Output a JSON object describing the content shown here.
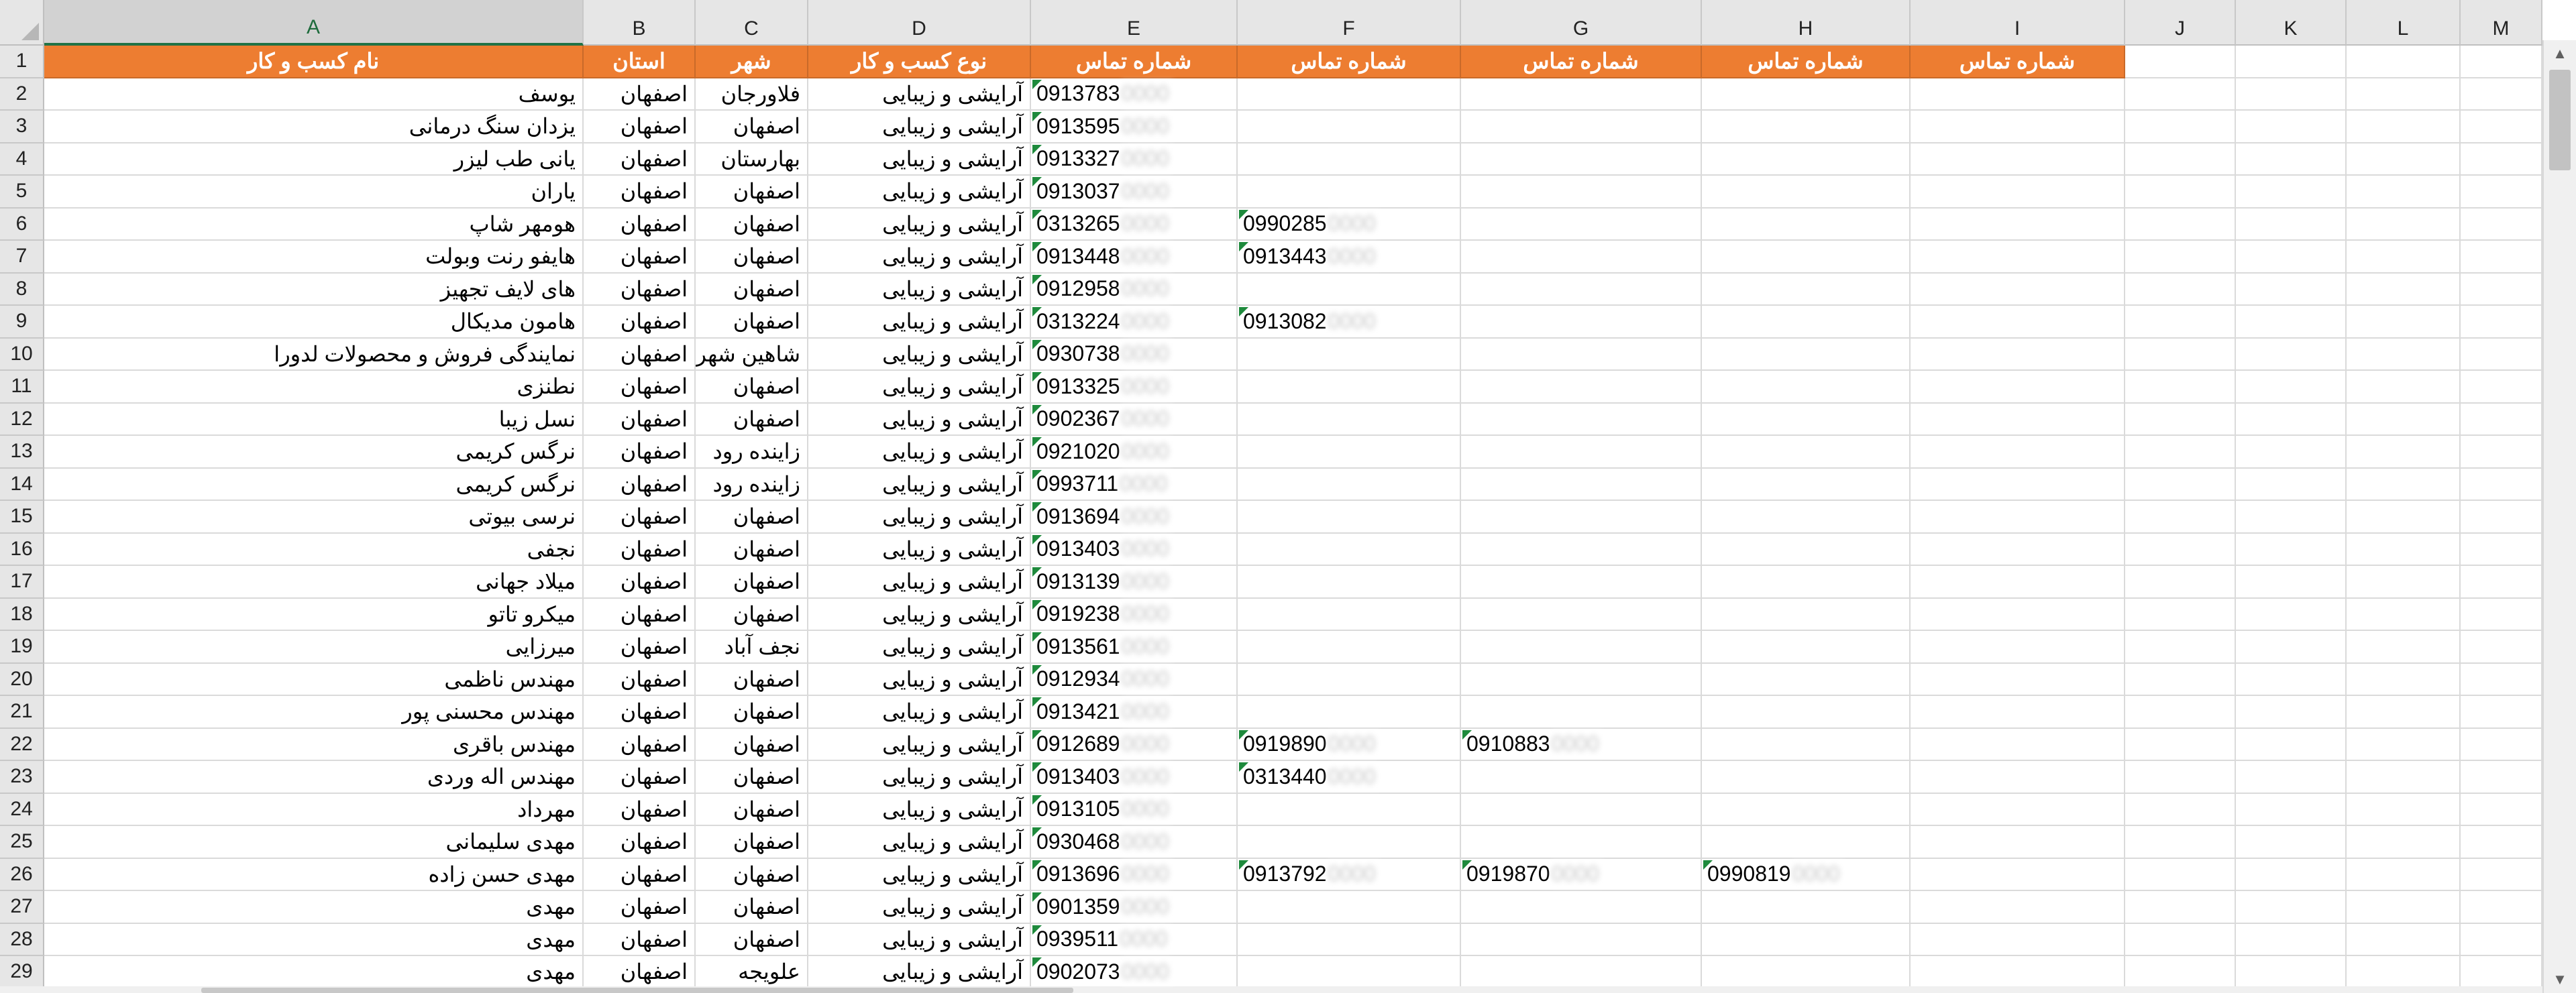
{
  "columns": [
    "A",
    "B",
    "C",
    "D",
    "E",
    "F",
    "G",
    "H",
    "I",
    "J",
    "K",
    "L",
    "M"
  ],
  "selected_column": "A",
  "row_numbers": [
    "1",
    "2",
    "3",
    "4",
    "5",
    "6",
    "7",
    "8",
    "9",
    "10",
    "11",
    "12",
    "13",
    "14",
    "15",
    "16",
    "17",
    "18",
    "19",
    "20",
    "21",
    "22",
    "23",
    "24",
    "25",
    "26",
    "27",
    "28",
    "29"
  ],
  "headers": [
    "نام کسب و کار",
    "استان",
    "شهر",
    "نوع کسب و کار",
    "شماره تماس",
    "شماره تماس",
    "شماره تماس",
    "شماره تماس",
    "شماره تماس"
  ],
  "header_fill_color": "#ed7d31",
  "rows": [
    {
      "name": "یوسف",
      "province": "اصفهان",
      "city": "فلاورجان",
      "type": "آرایشی و زیبایی",
      "phones": [
        "0913783"
      ]
    },
    {
      "name": "یزدان سنگ درمانی",
      "province": "اصفهان",
      "city": "اصفهان",
      "type": "آرایشی و زیبایی",
      "phones": [
        "0913595"
      ]
    },
    {
      "name": "یانی طب لیزر",
      "province": "اصفهان",
      "city": "بهارستان",
      "type": "آرایشی و زیبایی",
      "phones": [
        "0913327"
      ]
    },
    {
      "name": "یاران",
      "province": "اصفهان",
      "city": "اصفهان",
      "type": "آرایشی و زیبایی",
      "phones": [
        "0913037"
      ]
    },
    {
      "name": "هومهر شاپ",
      "province": "اصفهان",
      "city": "اصفهان",
      "type": "آرایشی و زیبایی",
      "phones": [
        "0313265",
        "0990285"
      ]
    },
    {
      "name": "هایفو رنت وبولت",
      "province": "اصفهان",
      "city": "اصفهان",
      "type": "آرایشی و زیبایی",
      "phones": [
        "0913448",
        "0913443"
      ]
    },
    {
      "name": "های لایف تجهیز",
      "province": "اصفهان",
      "city": "اصفهان",
      "type": "آرایشی و زیبایی",
      "phones": [
        "0912958"
      ]
    },
    {
      "name": "هامون مدیکال",
      "province": "اصفهان",
      "city": "اصفهان",
      "type": "آرایشی و زیبایی",
      "phones": [
        "0313224",
        "0913082"
      ]
    },
    {
      "name": "نمایندگی فروش و محصولات لدورا",
      "province": "اصفهان",
      "city": "شاهین شهر",
      "type": "آرایشی و زیبایی",
      "phones": [
        "0930738"
      ]
    },
    {
      "name": "نطنزی",
      "province": "اصفهان",
      "city": "اصفهان",
      "type": "آرایشی و زیبایی",
      "phones": [
        "0913325"
      ]
    },
    {
      "name": "نسل زیبا",
      "province": "اصفهان",
      "city": "اصفهان",
      "type": "آرایشی و زیبایی",
      "phones": [
        "0902367"
      ]
    },
    {
      "name": "نرگس کریمی",
      "province": "اصفهان",
      "city": "زاینده رود",
      "type": "آرایشی و زیبایی",
      "phones": [
        "0921020"
      ]
    },
    {
      "name": "نرگس کریمی",
      "province": "اصفهان",
      "city": "زاینده رود",
      "type": "آرایشی و زیبایی",
      "phones": [
        "0993711"
      ]
    },
    {
      "name": "نرسی بیوتی",
      "province": "اصفهان",
      "city": "اصفهان",
      "type": "آرایشی و زیبایی",
      "phones": [
        "0913694"
      ]
    },
    {
      "name": "نجفی",
      "province": "اصفهان",
      "city": "اصفهان",
      "type": "آرایشی و زیبایی",
      "phones": [
        "0913403"
      ]
    },
    {
      "name": "میلاد جهانی",
      "province": "اصفهان",
      "city": "اصفهان",
      "type": "آرایشی و زیبایی",
      "phones": [
        "0913139"
      ]
    },
    {
      "name": "میکرو تاتو",
      "province": "اصفهان",
      "city": "اصفهان",
      "type": "آرایشی و زیبایی",
      "phones": [
        "0919238"
      ]
    },
    {
      "name": "میرزایی",
      "province": "اصفهان",
      "city": "نجف آباد",
      "type": "آرایشی و زیبایی",
      "phones": [
        "0913561"
      ]
    },
    {
      "name": "مهندس ناظمی",
      "province": "اصفهان",
      "city": "اصفهان",
      "type": "آرایشی و زیبایی",
      "phones": [
        "0912934"
      ]
    },
    {
      "name": "مهندس محسنی پور",
      "province": "اصفهان",
      "city": "اصفهان",
      "type": "آرایشی و زیبایی",
      "phones": [
        "0913421"
      ]
    },
    {
      "name": "مهندس باقری",
      "province": "اصفهان",
      "city": "اصفهان",
      "type": "آرایشی و زیبایی",
      "phones": [
        "0912689",
        "0919890",
        "0910883"
      ]
    },
    {
      "name": "مهندس اله وردی",
      "province": "اصفهان",
      "city": "اصفهان",
      "type": "آرایشی و زیبایی",
      "phones": [
        "0913403",
        "0313440"
      ]
    },
    {
      "name": "مهرداد",
      "province": "اصفهان",
      "city": "اصفهان",
      "type": "آرایشی و زیبایی",
      "phones": [
        "0913105"
      ]
    },
    {
      "name": "مهدی سلیمانی",
      "province": "اصفهان",
      "city": "اصفهان",
      "type": "آرایشی و زیبایی",
      "phones": [
        "0930468"
      ]
    },
    {
      "name": "مهدی حسن زاده",
      "province": "اصفهان",
      "city": "اصفهان",
      "type": "آرایشی و زیبایی",
      "phones": [
        "0913696",
        "0913792",
        "0919870",
        "0990819"
      ]
    },
    {
      "name": "مهدی",
      "province": "اصفهان",
      "city": "اصفهان",
      "type": "آرایشی و زیبایی",
      "phones": [
        "0901359"
      ]
    },
    {
      "name": "مهدی",
      "province": "اصفهان",
      "city": "اصفهان",
      "type": "آرایشی و زیبایی",
      "phones": [
        "0939511"
      ]
    },
    {
      "name": "مهدی",
      "province": "اصفهان",
      "city": "علویجه",
      "type": "آرایشی و زیبایی",
      "phones": [
        "0902073"
      ]
    }
  ],
  "scrollbar": {
    "up_icon": "triangle-up-icon",
    "down_icon": "triangle-down-icon"
  }
}
